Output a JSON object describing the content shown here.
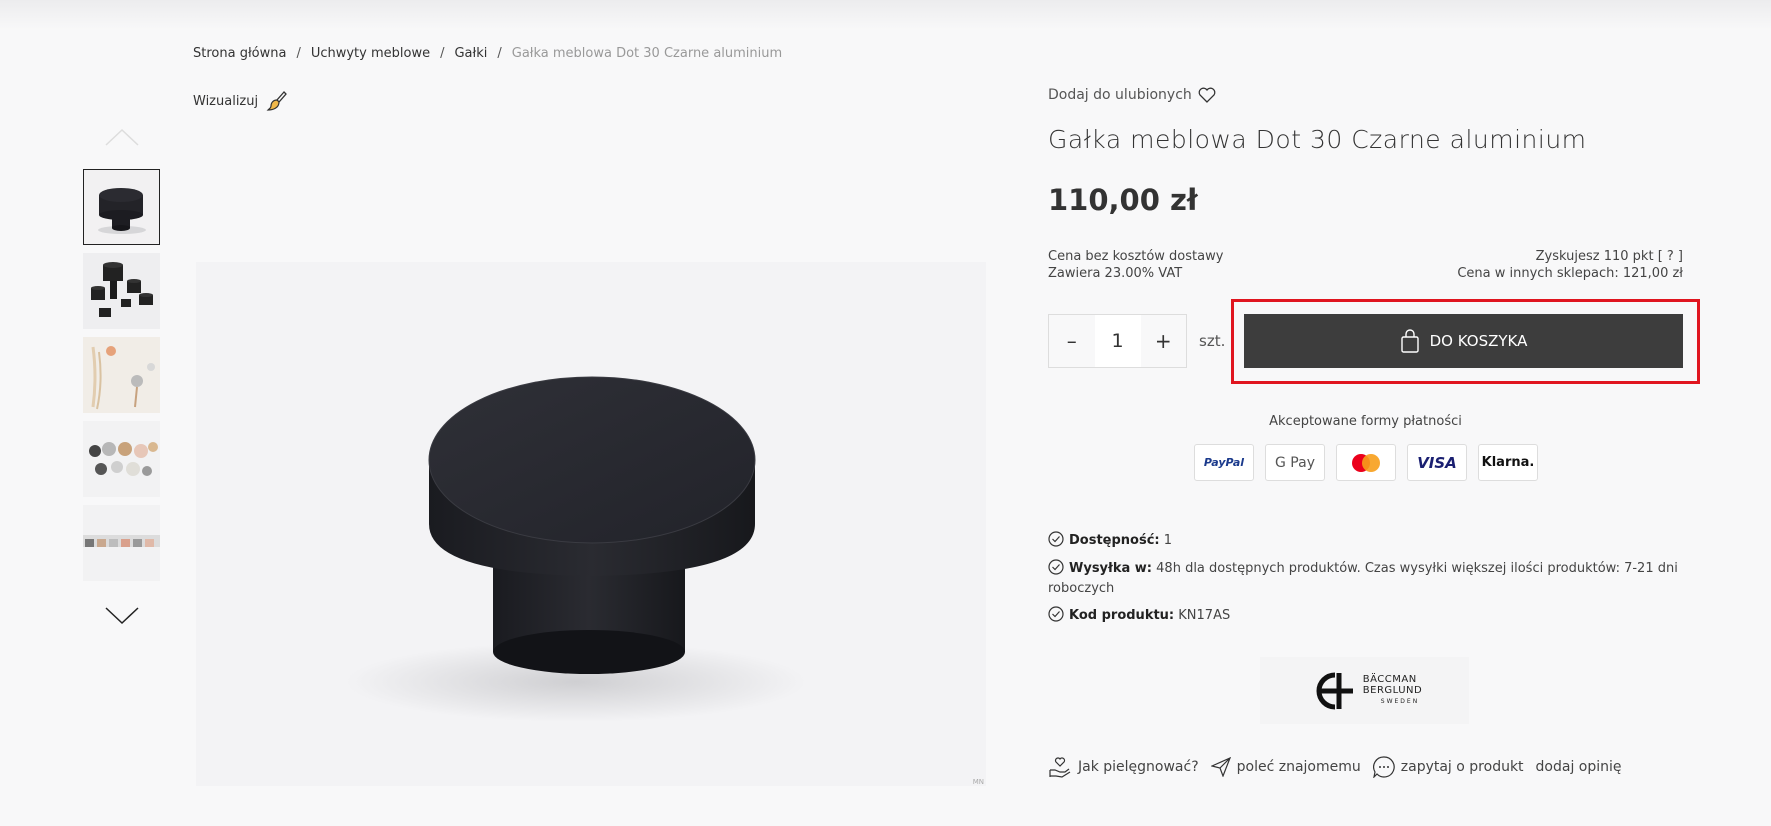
{
  "breadcrumb": {
    "home": "Strona główna",
    "cat1": "Uchwyty meblowe",
    "cat2": "Gałki",
    "current": "Gałka meblowa Dot 30 Czarne aluminium",
    "separator": "/"
  },
  "visualize_label": "Wizualizuj",
  "gallery": {
    "thumbnails": [
      "black knob",
      "black knobs set",
      "wall hooks with necklaces",
      "assorted knobs",
      "knobs row"
    ],
    "watermark": "MN"
  },
  "product": {
    "favorite_label": "Dodaj do ulubionych",
    "title": "Gałka meblowa Dot 30 Czarne aluminium",
    "price": "110,00 zł",
    "shipping_note": "Cena bez kosztów dostawy",
    "vat_note": "Zawiera 23.00% VAT",
    "points": "Zyskujesz 110 pkt [ ? ]",
    "other_price": "Cena w innych sklepach: 121,00 zł",
    "quantity": "1",
    "qty_minus": "–",
    "qty_plus": "+",
    "unit": "szt.",
    "add_to_cart": "DO KOSZYKA"
  },
  "payments": {
    "title": "Akceptowane formy płatności",
    "methods": [
      "PayPal",
      "G Pay",
      "Mastercard",
      "VISA",
      "Klarna."
    ]
  },
  "details": {
    "availability_label": "Dostępność:",
    "availability_value": "1",
    "shipping_label": "Wysyłka w:",
    "shipping_value": "48h dla dostępnych produktów. Czas wysyłki większej ilości produktów: 7-21 dni roboczych",
    "code_label": "Kod produktu:",
    "code_value": "KN17AS"
  },
  "brand": {
    "line1": "BÄCCMAN",
    "line2": "BERGLUND",
    "line3": "SWEDEN"
  },
  "actions": {
    "care": "Jak pielęgnować?",
    "recommend": "poleć znajomemu",
    "ask": "zapytaj o produkt",
    "review": "dodaj opinię"
  },
  "colors": {
    "accent_button": "#3d3d3d",
    "highlight": "#e0151f"
  }
}
